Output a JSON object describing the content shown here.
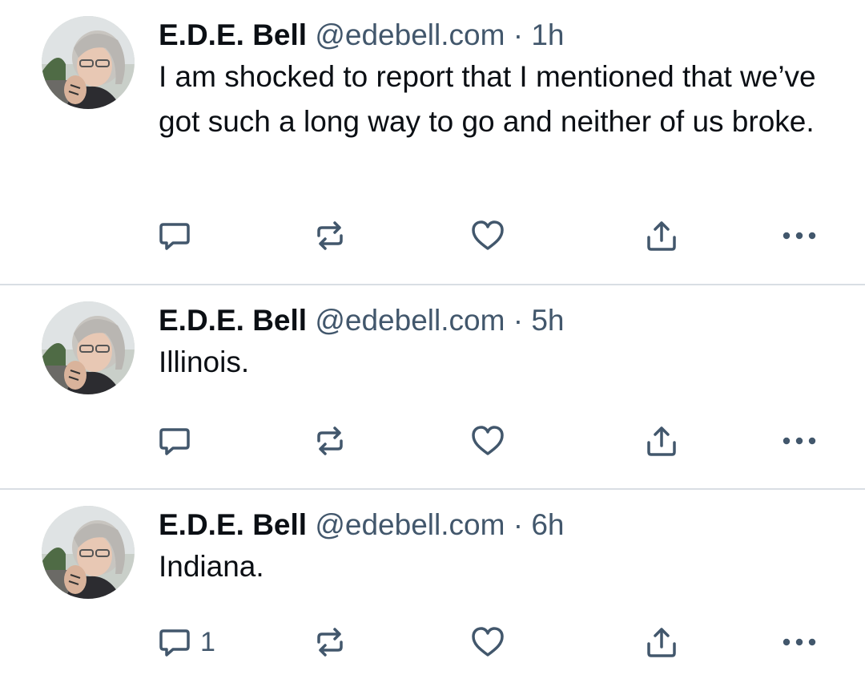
{
  "posts": [
    {
      "author": "E.D.E. Bell",
      "handle": "@edebell.com",
      "separator": "·",
      "time": "1h",
      "text": "I am shocked to report that I mentioned that we’ve got such a long way to go and neither of us broke.",
      "reply_count": ""
    },
    {
      "author": "E.D.E. Bell",
      "handle": "@edebell.com",
      "separator": "·",
      "time": "5h",
      "text": "Illinois.",
      "reply_count": ""
    },
    {
      "author": "E.D.E. Bell",
      "handle": "@edebell.com",
      "separator": "·",
      "time": "6h",
      "text": "Indiana.",
      "reply_count": "1"
    }
  ],
  "icons": {
    "reply": "reply-icon",
    "repost": "repost-icon",
    "like": "heart-icon",
    "share": "share-icon",
    "more": "more-icon"
  },
  "colors": {
    "text": "#0b0f14",
    "muted": "#42576c",
    "divider": "#d9dee4",
    "background": "#ffffff"
  }
}
